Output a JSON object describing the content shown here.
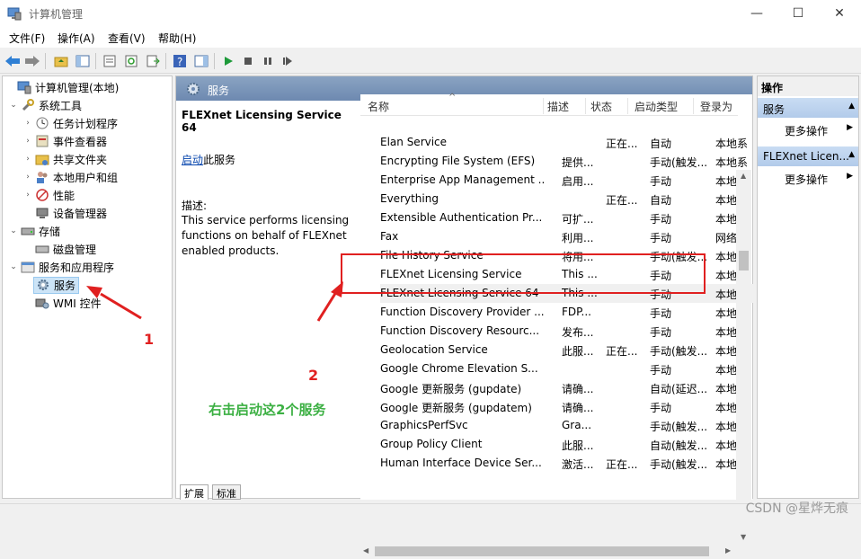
{
  "window": {
    "title": "计算机管理",
    "minimize": "—",
    "maximize": "☐",
    "close": "✕"
  },
  "menu": [
    "文件(F)",
    "操作(A)",
    "查看(V)",
    "帮助(H)"
  ],
  "tree": {
    "root": "计算机管理(本地)",
    "system_tools": "系统工具",
    "task_scheduler": "任务计划程序",
    "event_viewer": "事件查看器",
    "shared_folders": "共享文件夹",
    "local_users": "本地用户和组",
    "performance": "性能",
    "device_manager": "设备管理器",
    "storage": "存储",
    "disk_management": "磁盘管理",
    "services_apps": "服务和应用程序",
    "services": "服务",
    "wmi": "WMI 控件"
  },
  "center": {
    "header": "服务",
    "selected_title": "FLEXnet Licensing Service 64",
    "start_link": "启动",
    "start_suffix": "此服务",
    "desc_label": "描述:",
    "desc_text": "This service performs licensing functions on behalf of FLEXnet enabled products.",
    "tab_extended": "扩展",
    "tab_standard": "标准"
  },
  "columns": {
    "name": "名称",
    "desc": "描述",
    "state": "状态",
    "start": "启动类型",
    "login": "登录为"
  },
  "services": [
    {
      "name": "Elan Service",
      "desc": "",
      "state": "正在...",
      "start": "自动",
      "login": "本地系"
    },
    {
      "name": "Encrypting File System (EFS)",
      "desc": "提供...",
      "state": "",
      "start": "手动(触发...",
      "login": "本地系"
    },
    {
      "name": "Enterprise App Management ...",
      "desc": "启用...",
      "state": "",
      "start": "手动",
      "login": "本地系"
    },
    {
      "name": "Everything",
      "desc": "",
      "state": "正在...",
      "start": "自动",
      "login": "本地系"
    },
    {
      "name": "Extensible Authentication Pr...",
      "desc": "可扩...",
      "state": "",
      "start": "手动",
      "login": "本地系"
    },
    {
      "name": "Fax",
      "desc": "利用...",
      "state": "",
      "start": "手动",
      "login": "网络服"
    },
    {
      "name": "File History Service",
      "desc": "将用...",
      "state": "",
      "start": "手动(触发...",
      "login": "本地系"
    },
    {
      "name": "FLEXnet Licensing Service",
      "desc": "This ...",
      "state": "",
      "start": "手动",
      "login": "本地系"
    },
    {
      "name": "FLEXnet Licensing Service 64",
      "desc": "This ...",
      "state": "",
      "start": "手动",
      "login": "本地系"
    },
    {
      "name": "Function Discovery Provider ...",
      "desc": "FDP...",
      "state": "",
      "start": "手动",
      "login": "本地服"
    },
    {
      "name": "Function Discovery Resourc...",
      "desc": "发布...",
      "state": "",
      "start": "手动",
      "login": "本地服"
    },
    {
      "name": "Geolocation Service",
      "desc": "此服...",
      "state": "正在...",
      "start": "手动(触发...",
      "login": "本地系"
    },
    {
      "name": "Google Chrome Elevation S...",
      "desc": "",
      "state": "",
      "start": "手动",
      "login": "本地系"
    },
    {
      "name": "Google 更新服务 (gupdate)",
      "desc": "请确...",
      "state": "",
      "start": "自动(延迟...",
      "login": "本地系"
    },
    {
      "name": "Google 更新服务 (gupdatem)",
      "desc": "请确...",
      "state": "",
      "start": "手动",
      "login": "本地系"
    },
    {
      "name": "GraphicsPerfSvc",
      "desc": "Gra...",
      "state": "",
      "start": "手动(触发...",
      "login": "本地系"
    },
    {
      "name": "Group Policy Client",
      "desc": "此服...",
      "state": "",
      "start": "自动(触发...",
      "login": "本地系"
    },
    {
      "name": "Human Interface Device Ser...",
      "desc": "激活...",
      "state": "正在...",
      "start": "手动(触发...",
      "login": "本地系"
    }
  ],
  "actions": {
    "header": "操作",
    "section1": "服务",
    "more1": "更多操作",
    "section2": "FLEXnet Licen...",
    "more2": "更多操作"
  },
  "annotations": {
    "num1": "1",
    "num2": "2",
    "instruction": "右击启动这2个服务"
  },
  "watermark": "CSDN @星烨无痕",
  "colors": {
    "annotation_red": "#e02020",
    "annotation_green": "#3cb043",
    "header_blue": "#7a94b8"
  }
}
